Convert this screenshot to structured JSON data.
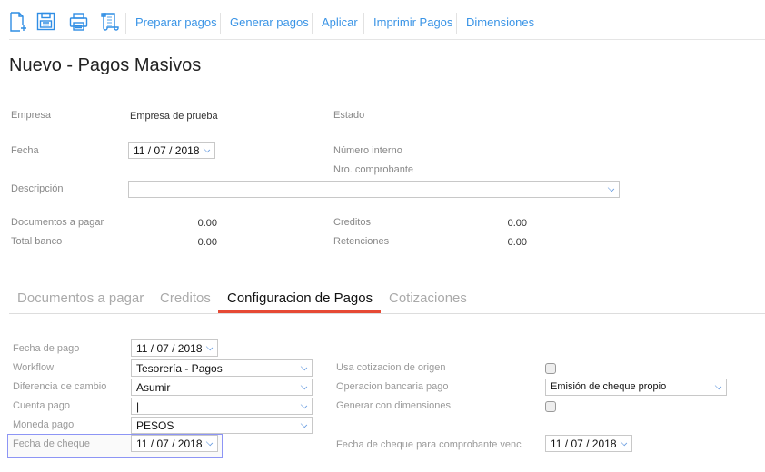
{
  "toolbar": {
    "icons": [
      "new-document-icon",
      "save-icon",
      "print-icon",
      "scroll-icon"
    ],
    "links": [
      "Preparar pagos",
      "Generar pagos",
      "Aplicar",
      "Imprimir Pagos",
      "Dimensiones"
    ]
  },
  "page_title": "Nuevo - Pagos Masivos",
  "header": {
    "empresa_label": "Empresa",
    "empresa_value": "Empresa de prueba",
    "estado_label": "Estado",
    "fecha_label": "Fecha",
    "fecha_value": "11 / 07 /  2018",
    "numero_interno_label": "Número interno",
    "nro_comprobante_label": "Nro. comprobante",
    "descripcion_label": "Descripción",
    "descripcion_value": "",
    "documentos_label": "Documentos a pagar",
    "documentos_value": "0.00",
    "total_banco_label": "Total banco",
    "total_banco_value": "0.00",
    "creditos_label": "Creditos",
    "creditos_value": "0.00",
    "retenciones_label": "Retenciones",
    "retenciones_value": "0.00"
  },
  "tabs": [
    {
      "label": "Documentos a pagar"
    },
    {
      "label": "Creditos"
    },
    {
      "label": "Configuracion de Pagos",
      "active": true
    },
    {
      "label": "Cotizaciones"
    }
  ],
  "config": {
    "fecha_pago_label": "Fecha de pago",
    "fecha_pago_value": "11 / 07 /  2018",
    "workflow_label": "Workflow",
    "workflow_value": "Tesorería - Pagos",
    "diferencia_label": "Diferencia de cambio",
    "diferencia_value": "Asumir",
    "cuenta_label": "Cuenta pago",
    "cuenta_value": "|",
    "moneda_label": "Moneda pago",
    "moneda_value": "PESOS",
    "fecha_cheque_label": "Fecha de cheque",
    "fecha_cheque_value": "11 / 07 /  2018",
    "usa_cotizacion_label": "Usa cotizacion de origen",
    "usa_cotizacion_checked": false,
    "operacion_label": "Operacion bancaria pago",
    "operacion_value": "Emisión de cheque propio",
    "generar_dim_label": "Generar con dimensiones",
    "generar_dim_checked": false,
    "fecha_cheque_venc_label": "Fecha de cheque para comprobante venc",
    "fecha_cheque_venc_value": "11 / 07 /  2018"
  },
  "colors": {
    "accent": "#3a94e6",
    "tab_indicator": "#e64a35",
    "focus": "#8d95f5"
  }
}
